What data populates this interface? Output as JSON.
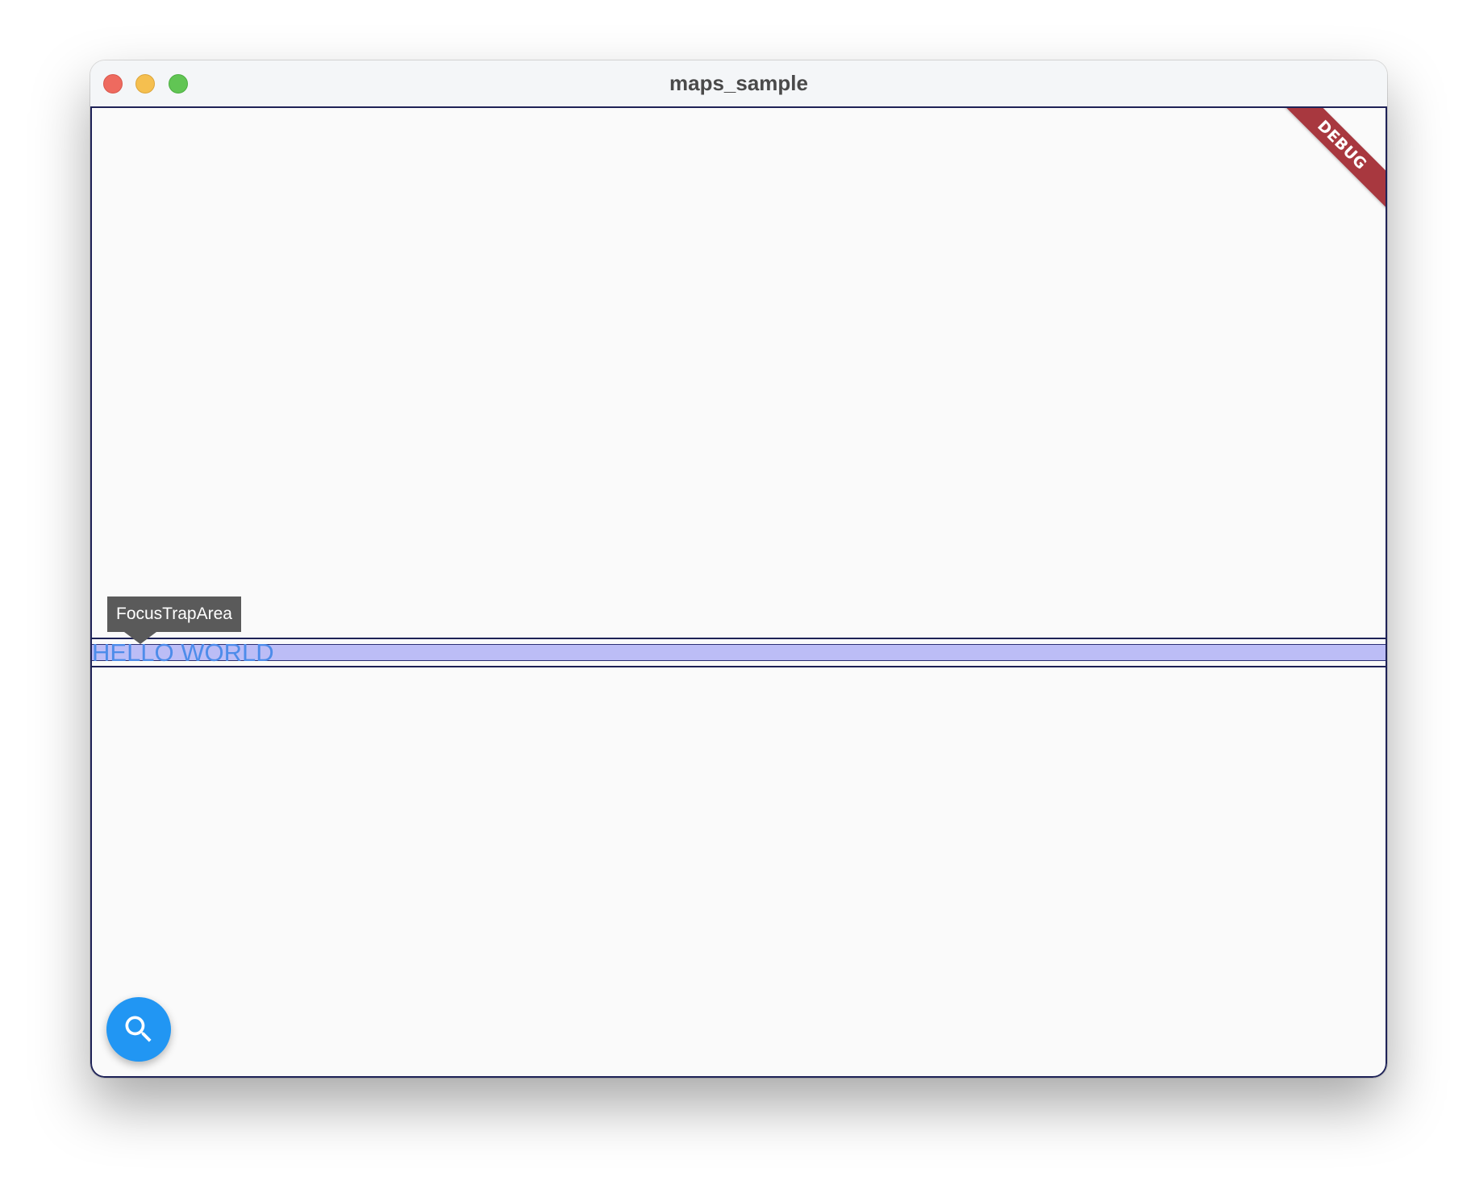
{
  "window": {
    "title": "maps_sample"
  },
  "debug_banner": {
    "label": "DEBUG",
    "color": "#a8383f"
  },
  "tooltip": {
    "text": "FocusTrapArea"
  },
  "text_field": {
    "value": "HELLO WORLD",
    "text_color": "#4d8cea",
    "selection_color": "#bcbdf6"
  },
  "fab": {
    "icon": "search-icon",
    "color": "#2196f3"
  },
  "colors": {
    "traffic_close": "#ee6a5f",
    "traffic_minimize": "#f5bf4f",
    "traffic_zoom": "#61c554",
    "outline": "#1e2257"
  }
}
